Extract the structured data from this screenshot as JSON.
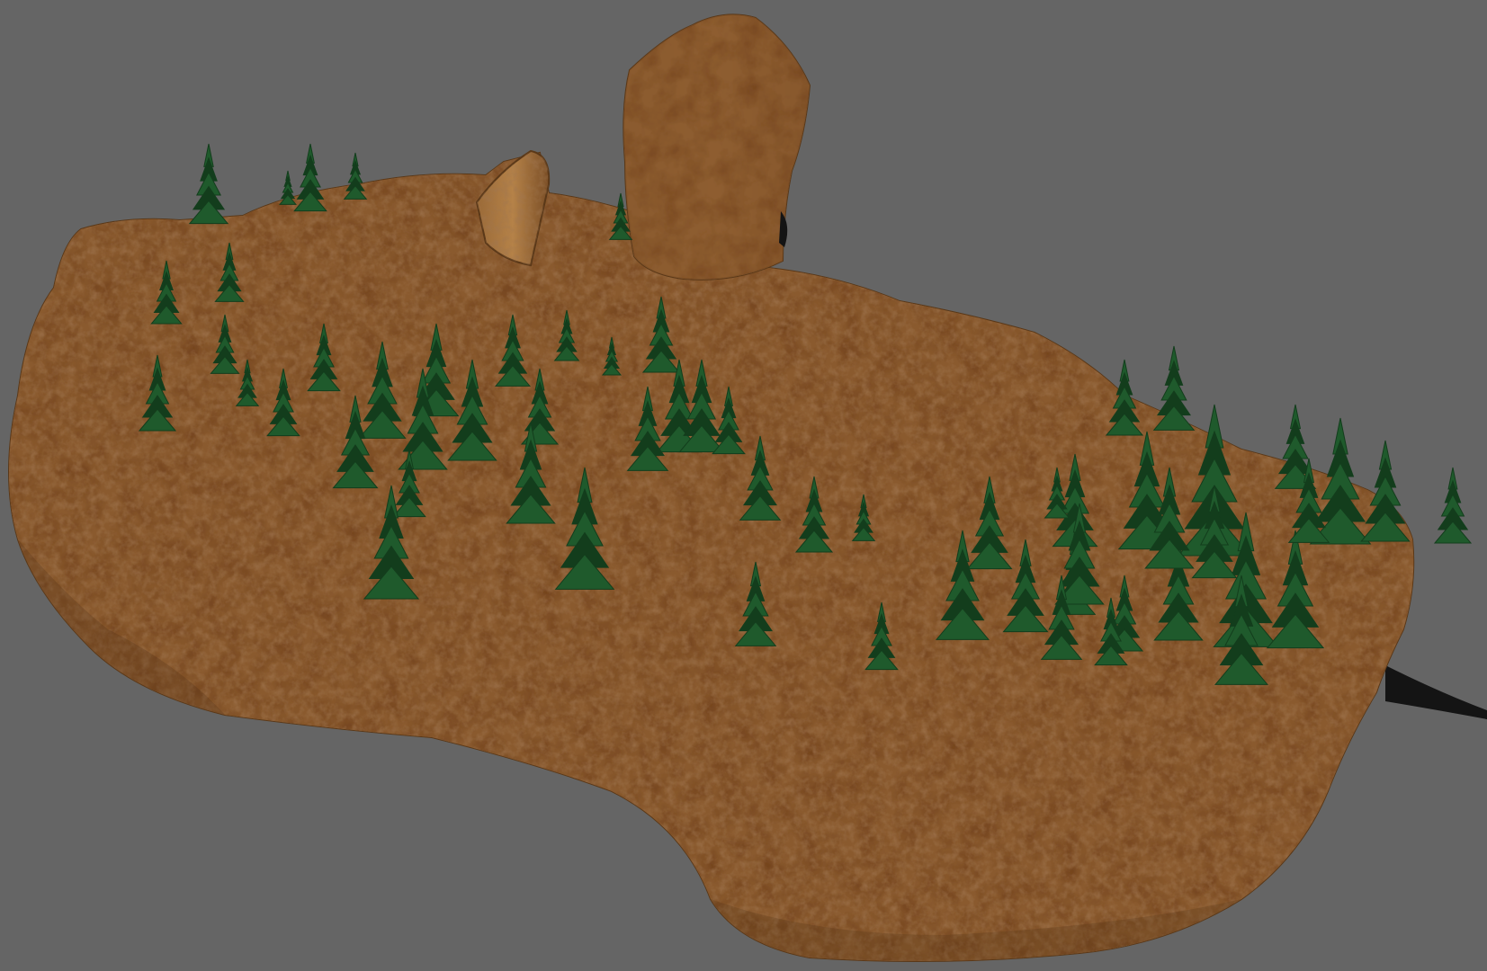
{
  "scene": {
    "background_color": "#656565",
    "rock_base_color": "#8a5a2e",
    "rock_highlight_color": "#b07d45",
    "rock_shadow_color": "#4a2c14",
    "tree_color": "#1f5a2c",
    "tree_dark_color": "#133d1c"
  }
}
